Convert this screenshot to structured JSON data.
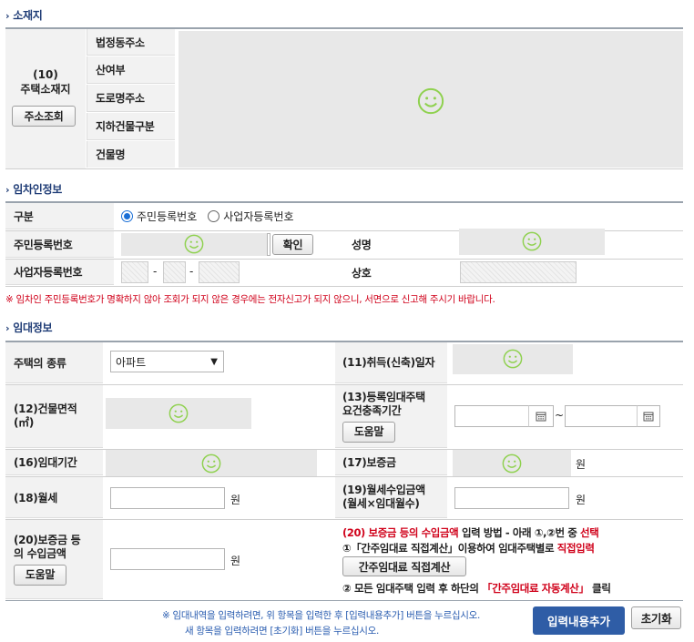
{
  "sections": {
    "location": "소재지",
    "tenant": "임차인정보",
    "lease": "임대정보"
  },
  "location": {
    "label_num": "(10)",
    "label_text": "주택소재지",
    "lookup_button": "주소조회",
    "rows": [
      "법정동주소",
      "산여부",
      "도로명주소",
      "지하건물구분",
      "건물명"
    ]
  },
  "tenant": {
    "type_label": "구분",
    "radio_resident": "주민등록번호",
    "radio_business": "사업자등록번호",
    "resident_label": "주민등록번호",
    "confirm_button": "확인",
    "name_label": "성명",
    "bizno_label": "사업자등록번호",
    "dash1": "-",
    "dash2": "-",
    "company_label": "상호",
    "warning": "※ 임차인 주민등록번호가 명확하지 않아 조회가 되지 않은 경우에는 전자신고가 되지 않으니, 서면으로 신고해 주시기 바랍니다."
  },
  "lease": {
    "house_type_label": "주택의 종류",
    "house_type_value": "아파트",
    "acq_date_label": "(11)취득(신축)일자",
    "area_label_1": "(12)건물면적",
    "area_label_2": "(㎡)",
    "period_label_1": "(13)등록임대주택",
    "period_label_2": "요건충족기간",
    "help_button": "도움말",
    "tilde": "~",
    "lease_period_label": "(16)임대기간",
    "deposit_label": "(17)보증금",
    "won": "원",
    "rent_label": "(18)월세",
    "monthly_income_label_1": "(19)월세수입금액",
    "monthly_income_label_2": "(월세×임대월수)",
    "deposit_income_label_1": "(20)보증금 등",
    "deposit_income_label_2": "의 수입금액",
    "help_button2": "도움말",
    "method_line1_a": "(20) 보증금 등의 수입금액",
    "method_line1_b": " 입력 방법 - 아래 ①,②번 중 ",
    "method_line1_c": "선택",
    "method_line2_a": "①「간주임대료 직접계산」이용하여 임대주택별로 ",
    "method_line2_b": "직접입력",
    "direct_calc_button": "간주임대료 직접계산",
    "method_line3_a": "② 모든 임대주택 입력 후 하단의 ",
    "method_line3_b": "「간주임대료 자동계산」",
    "method_line3_c": " 클릭"
  },
  "footer": {
    "note1": "※ 임대내역을 입력하려면, 위 항목을 입력한 후 [입력내용추가] 버튼을 누르십시오.",
    "note2": "새 항목을 입력하려면 [초기화] 버튼을 누르십시오.",
    "add_button": "입력내용추가",
    "reset_button": "초기화"
  },
  "colors": {
    "section_title": "#1f3c76",
    "add_button_bg": "#2f5da6",
    "warning": "#d0021b"
  }
}
